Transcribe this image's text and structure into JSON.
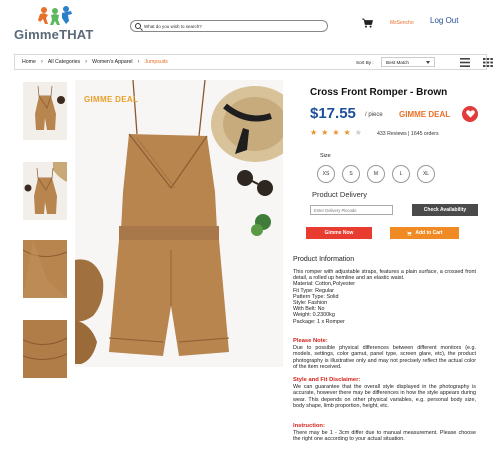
{
  "header": {
    "logo_text": "GimmeTHAT",
    "search_placeholder": "What do you wish to search?",
    "user_name": "MsSencho",
    "logout_label": "Log Out"
  },
  "breadcrumb": {
    "items": [
      "Home",
      "All Categories",
      "Women's Apparel",
      "Jumpsuits"
    ],
    "sort_label": "Sort By :",
    "sort_value": "Best Match"
  },
  "product": {
    "image_deal_tag": "GIMME DEAL",
    "title": "Cross Front Romper - Brown",
    "price": "$17.55",
    "price_unit": "/ piece",
    "deal_badge": "GIMME DEAL",
    "rating": 4,
    "rating_max": 5,
    "reviews_text": "433 Reviews | 1645 orders",
    "size_label": "Size",
    "sizes": [
      "XS",
      "S",
      "M",
      "L",
      "XL"
    ],
    "delivery_label": "Product Delivery",
    "pincode_placeholder": "Enter Delivery Pincode",
    "check_label": "Check Availability",
    "gimme_now_label": "Gimme Now",
    "add_to_cart_label": "Add to Cart"
  },
  "info": {
    "title": "Product Information",
    "description": "This romper with adjustable straps, features a plain surface, a crossed front detail, a rolled up hemline and an elastic waist.",
    "specs": [
      "Material: Cotton,Polyester",
      "Fit Type: Regular",
      "Pattern Type: Solid",
      "Style: Fashion",
      "With Belt: No",
      "Weight: 0.2300kg",
      "Package: 1 x Romper"
    ],
    "please_note_title": "Please Note:",
    "please_note_body": "Due to possible physical differences between different monitors (e.g. models, settings, color gamut, panel type, screen glare, etc), the product photography is illustrative only and may not precisely reflect the actual color of the item received.",
    "style_title": "Style and Fit Disclaimer:",
    "style_body": "We can guarantee that the overall style displayed in the photography is accurate, however there may be differences in how the style appears during wear. This depends on other physical variables, e.g. personal body size, body shape, limb proportion, height, etc.",
    "instruction_title": "Instruction:",
    "instruction_body": "There may be 1 - 3cm differ due to manual measurement. Please choose the right one according to your actual situation."
  },
  "colors": {
    "brand_blue": "#1e4f9a",
    "accent_orange": "#e8702a",
    "deal_gold": "#e8a02a",
    "heart_red": "#e23b3b",
    "gimme_red": "#e73c2f",
    "cart_orange": "#f08a24",
    "star_gold": "#e8922a",
    "romper_brown": "#b8854f"
  },
  "icons": {
    "cart": "cart-icon",
    "search": "search-icon",
    "favorite": "heart-icon",
    "list_view": "list-view-icon",
    "grid_view": "grid-view-icon"
  }
}
